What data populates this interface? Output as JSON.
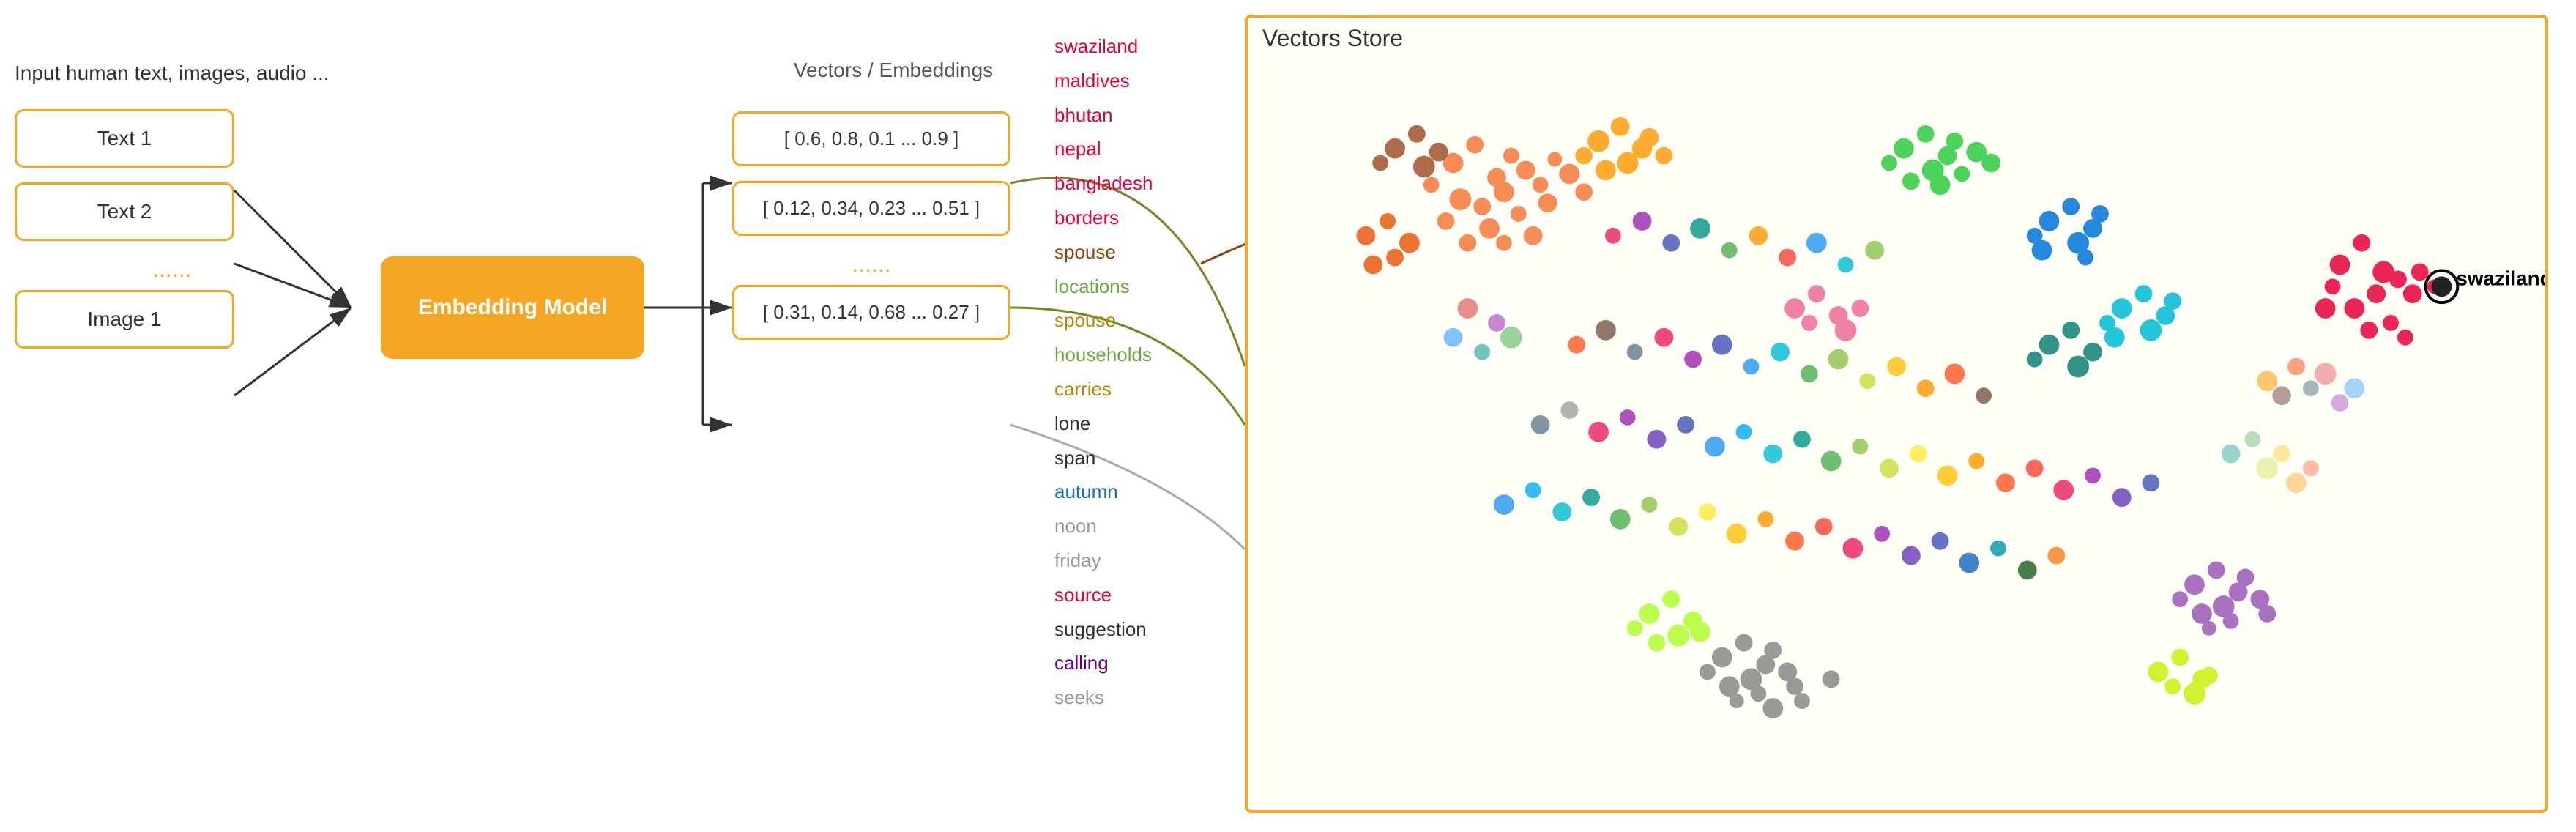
{
  "input": {
    "description": "Input human text, images,\naudio ...",
    "boxes": [
      {
        "label": "Text 1"
      },
      {
        "label": "Text 2"
      },
      {
        "label": "Image 1"
      }
    ],
    "dots": "......"
  },
  "embedding_model": {
    "label": "Embedding Model"
  },
  "vectors": {
    "title": "Vectors / Embeddings",
    "items": [
      {
        "value": "[ 0.6, 0.8, 0.1 ... 0.9 ]"
      },
      {
        "value": "[ 0.12, 0.34, 0.23 ... 0.51 ]"
      },
      {
        "value": "[ 0.31, 0.14, 0.68 ... 0.27 ]"
      }
    ],
    "dots": "......"
  },
  "word_list": {
    "items": [
      {
        "word": "swaziland",
        "color": "#e8003a"
      },
      {
        "word": "maldives",
        "color": "#e8003a"
      },
      {
        "word": "bhutan",
        "color": "#e8003a"
      },
      {
        "word": "nepal",
        "color": "#e8003a"
      },
      {
        "word": "bangladesh",
        "color": "#e8003a"
      },
      {
        "word": "borders",
        "color": "#e8003a"
      },
      {
        "word": "spouse",
        "color": "#8b4513"
      },
      {
        "word": "locations",
        "color": "#6aaa3a"
      },
      {
        "word": "spouse",
        "color": "#b8860b"
      },
      {
        "word": "households",
        "color": "#6aaa3a"
      },
      {
        "word": "carries",
        "color": "#b8860b"
      },
      {
        "word": "lone",
        "color": "#333"
      },
      {
        "word": "span",
        "color": "#333"
      },
      {
        "word": "autumn",
        "color": "#1a6fc4"
      },
      {
        "word": "noon",
        "color": "#999"
      },
      {
        "word": "friday",
        "color": "#999"
      },
      {
        "word": "source",
        "color": "#e8003a"
      },
      {
        "word": "suggestion",
        "color": "#333"
      },
      {
        "word": "calling",
        "color": "#6a0080"
      },
      {
        "word": "seeks",
        "color": "#999"
      }
    ]
  },
  "vectors_store": {
    "title": "Vectors Store",
    "swaziland_label": "swaziland"
  },
  "colors": {
    "yellow": "#f5a623",
    "accent": "#f5a623"
  }
}
